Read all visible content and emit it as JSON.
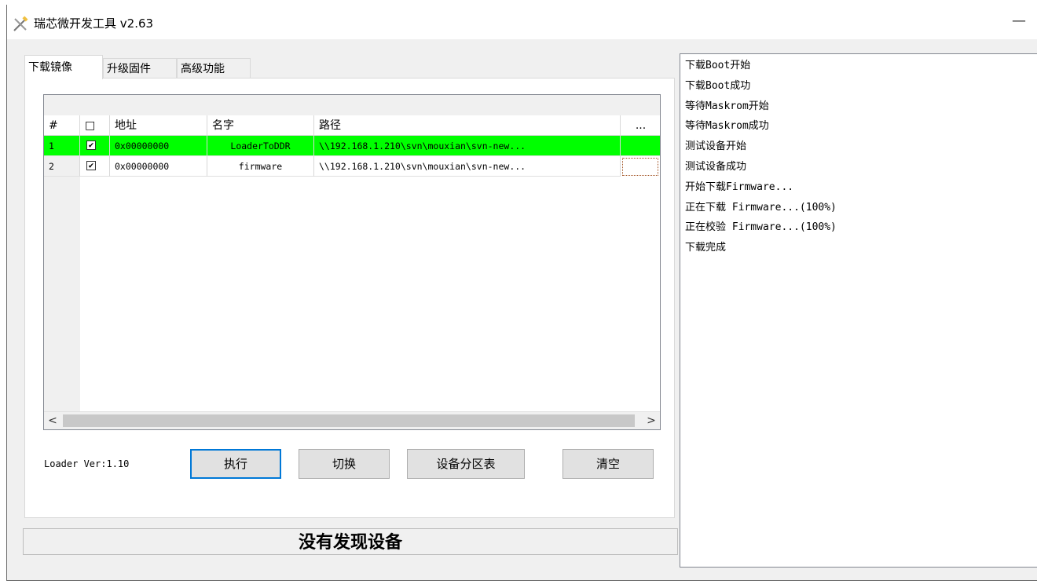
{
  "window": {
    "title": "瑞芯微开发工具 v2.63",
    "minimize_glyph": "—"
  },
  "tabs": [
    {
      "label": "下载镜像",
      "active": true
    },
    {
      "label": "升级固件",
      "active": false
    },
    {
      "label": "高级功能",
      "active": false
    }
  ],
  "table": {
    "headers": {
      "num": "#",
      "check": "□",
      "address": "地址",
      "name": "名字",
      "path": "路径",
      "more": "..."
    },
    "rows": [
      {
        "num": "1",
        "checked": "✔",
        "address": "0x00000000",
        "name": "LoaderToDDR",
        "path": "\\\\192.168.1.210\\svn\\mouxian\\svn-new...",
        "highlight": "#00ff00"
      },
      {
        "num": "2",
        "checked": "✔",
        "address": "0x00000000",
        "name": "firmware",
        "path": "\\\\192.168.1.210\\svn\\mouxian\\svn-new..."
      }
    ],
    "scroll_left": "<",
    "scroll_right": ">"
  },
  "loader_version": "Loader Ver:1.10",
  "buttons": {
    "execute": "执行",
    "switch": "切换",
    "partition_table": "设备分区表",
    "clear": "清空"
  },
  "status": "没有发现设备",
  "log": [
    "下载Boot开始",
    "下载Boot成功",
    "等待Maskrom开始",
    "等待Maskrom成功",
    "测试设备开始",
    "测试设备成功",
    "开始下载Firmware...",
    "正在下载 Firmware...(100%)",
    "正在校验 Firmware...(100%)",
    "下载完成"
  ],
  "colors": {
    "highlight_row": "#00ff00",
    "primary_button_border": "#0078d7"
  }
}
